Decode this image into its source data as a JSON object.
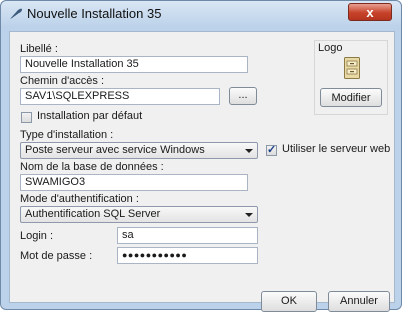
{
  "window": {
    "title": "Nouvelle Installation 35",
    "close_label": "x"
  },
  "form": {
    "libelle_label": "Libellé :",
    "libelle_value": "Nouvelle Installation 35",
    "chemin_label": "Chemin d'accès :",
    "chemin_value": "SAV1\\SQLEXPRESS",
    "browse_label": "...",
    "installation_defaut_label": "Installation par défaut",
    "installation_defaut_checked": false,
    "type_label": "Type d'installation :",
    "type_value": "Poste serveur avec service Windows",
    "serveur_web_label": "Utiliser le serveur web",
    "serveur_web_checked": true,
    "base_label": "Nom de la base de données :",
    "base_value": "SWAMIGO3",
    "auth_label": "Mode d'authentification :",
    "auth_value": "Authentification SQL Server",
    "login_label": "Login :",
    "login_value": "sa",
    "password_label": "Mot de passe :",
    "password_value": "●●●●●●●●●●●"
  },
  "logo": {
    "label": "Logo",
    "icon": "cabinet-icon",
    "modify_label": "Modifier"
  },
  "footer": {
    "ok_label": "OK",
    "cancel_label": "Annuler"
  }
}
